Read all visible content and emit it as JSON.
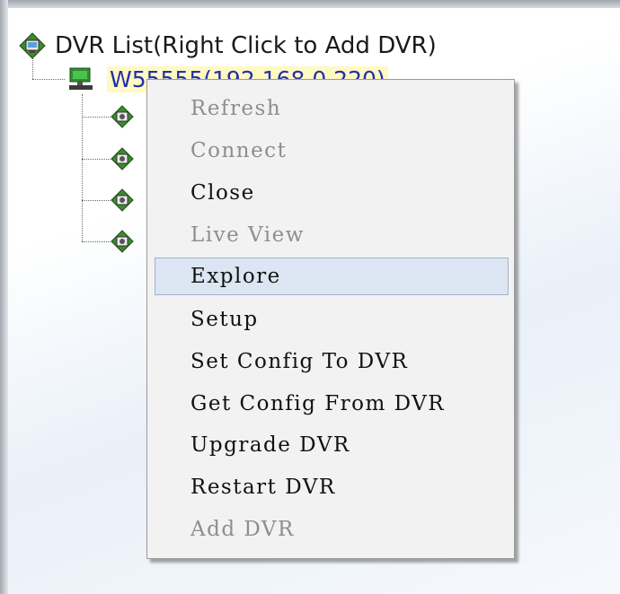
{
  "tree": {
    "root_label": "DVR List(Right Click to Add DVR)",
    "root_icon": "dvr-list-icon",
    "node_label": "W55555(192.168.0.220)",
    "node_icon": "computer-icon",
    "camera_icon": "camera-channel-icon",
    "camera_count": 4
  },
  "context_menu": {
    "items": [
      {
        "label": "Refresh",
        "enabled": false
      },
      {
        "label": "Connect",
        "enabled": false
      },
      {
        "label": "Close",
        "enabled": true
      },
      {
        "label": "Live View",
        "enabled": false
      },
      {
        "label": "Explore",
        "enabled": true,
        "highlighted": true
      },
      {
        "label": "Setup",
        "enabled": true
      },
      {
        "label": "Set Config To DVR",
        "enabled": true
      },
      {
        "label": "Get Config From DVR",
        "enabled": true
      },
      {
        "label": "Upgrade DVR",
        "enabled": true
      },
      {
        "label": "Restart DVR",
        "enabled": true
      },
      {
        "label": "Add DVR",
        "enabled": false
      }
    ]
  },
  "colors": {
    "highlight_bg": "#dce6f2",
    "highlight_border": "#9fb3cc",
    "disabled_text": "#8e8e8e",
    "node_label_text": "#2230a8",
    "node_label_bg": "#fff9c4"
  }
}
